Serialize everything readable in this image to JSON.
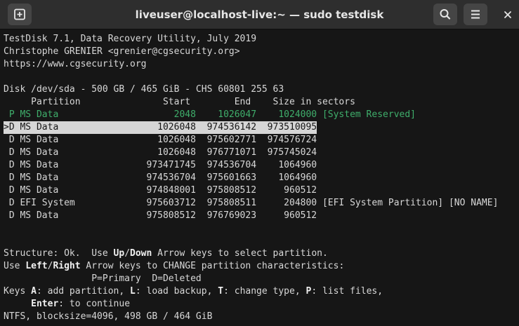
{
  "window": {
    "title": "liveuser@localhost-live:~ — sudo testdisk"
  },
  "icons": {
    "new_tab": "plus-square-icon",
    "search": "search-icon",
    "menu": "hamburger-menu-icon",
    "close": "close-icon"
  },
  "terminal": {
    "header": [
      "TestDisk 7.1, Data Recovery Utility, July 2019",
      "Christophe GRENIER <grenier@cgsecurity.org>",
      "https://www.cgsecurity.org"
    ],
    "disk_line": "Disk /dev/sda - 500 GB / 465 GiB - CHS 60801 255 63",
    "columns_line": "     Partition               Start        End    Size in sectors",
    "partitions": [
      "P MS Data                     2048    1026047    1024000 [System Reserved]",
      "D MS Data                  1026048  974536142  973510095",
      "D MS Data                  1026048  975602771  974576724",
      "D MS Data                  1026048  976771071  975745024",
      "D MS Data                973471745  974536704    1064960",
      "D MS Data                974536704  975601663    1064960",
      "D MS Data                974848001  975808512     960512",
      "D EFI System             975603712  975808511     204800 [EFI System Partition] [NO NAME]",
      "D MS Data                975808512  976769023     960512"
    ],
    "cursor": ">",
    "footer": {
      "l1_a": "Structure: Ok.  Use ",
      "l1_up": "Up",
      "l1_slash": "/",
      "l1_down": "Down",
      "l1_b": " Arrow keys to select partition.",
      "l2_a": "Use ",
      "l2_left": "Left",
      "l2_slash": "/",
      "l2_right": "Right",
      "l2_b": " Arrow keys to CHANGE partition characteristics:",
      "l3": "                P=Primary  D=Deleted",
      "l4_a": "Keys ",
      "l4_k1": "A",
      "l4_b": ": add partition, ",
      "l4_k2": "L",
      "l4_c": ": load backup, ",
      "l4_k3": "T",
      "l4_d": ": change type, ",
      "l4_k4": "P",
      "l4_e": ": list files,",
      "l5_a": "     ",
      "l5_enter": "Enter",
      "l5_b": ": to continue",
      "l6": "NTFS, blocksize=4096, 498 GB / 464 GiB"
    }
  }
}
